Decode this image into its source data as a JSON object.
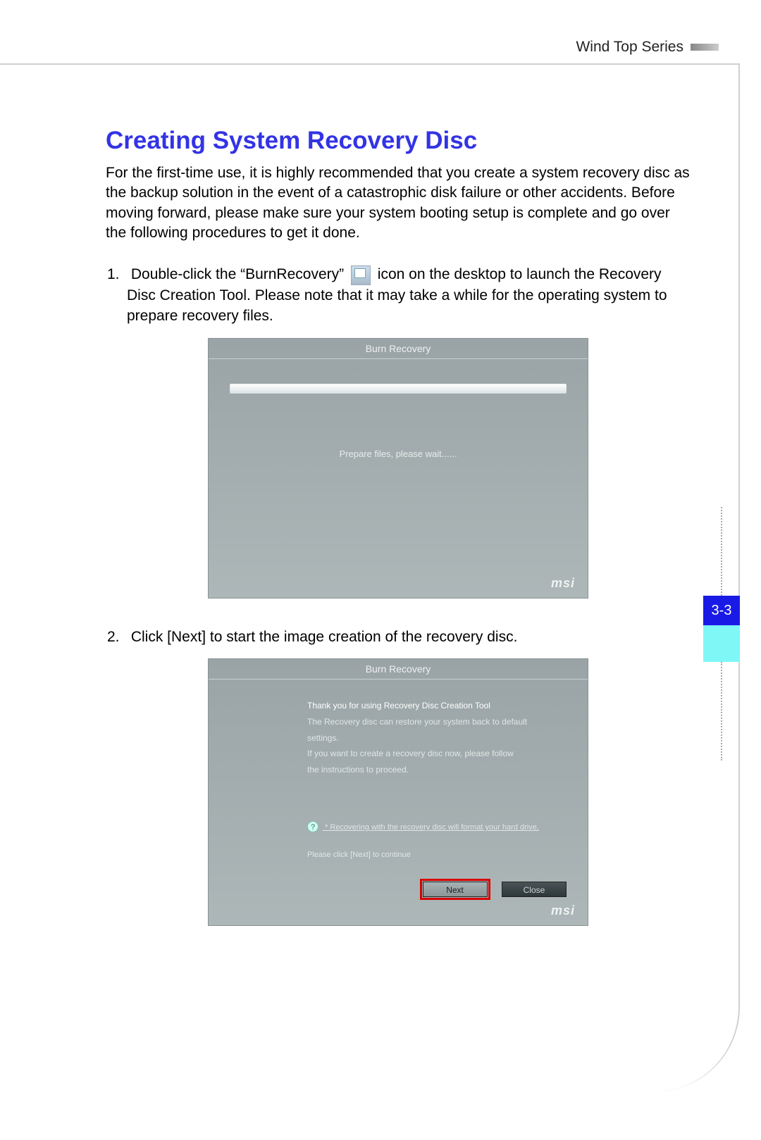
{
  "header": {
    "series": "Wind Top Series"
  },
  "page": {
    "number": "3-3"
  },
  "title": "Creating System Recovery Disc",
  "intro": "For the first-time use, it is highly recommended that you create a system recovery disc as the backup solution in the event of a catastrophic disk failure or other accidents. Before moving forward, please make sure your system booting setup is complete and go over the following procedures to get it done.",
  "steps": {
    "s1_pre": "Double-click the “BurnRecovery” ",
    "s1_post": " icon on the desktop to launch the Recovery Disc Creation Tool. Please note that it may take a while for the operating system to prepare recovery files.",
    "s2": "Click [Next] to start the image creation of the recovery disc."
  },
  "shot1": {
    "title": "Burn Recovery",
    "prepare": "Prepare files, please wait......",
    "brand": "msi"
  },
  "shot2": {
    "title": "Burn Recovery",
    "line1": "Thank you for using Recovery Disc Creation Tool",
    "line2": "The Recovery disc can restore your system back to default settings.",
    "line3": "If you want to create a recovery disc now, please follow",
    "line4": "the instructions to proceed.",
    "warn": "* Recovering with the recovery disc will format your hard drive.",
    "clicknext": "Please click [Next] to continue",
    "next": "Next",
    "close": "Close",
    "brand": "msi",
    "help": "?"
  }
}
